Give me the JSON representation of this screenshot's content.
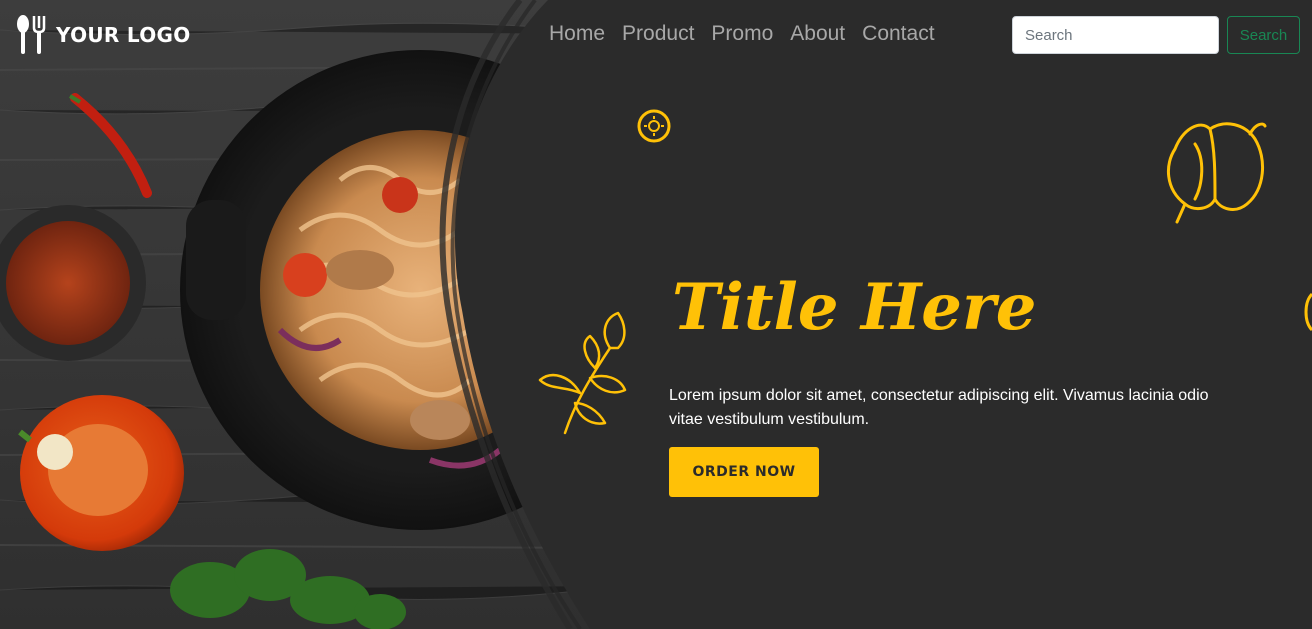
{
  "logo": {
    "text": "YOUR LOGO",
    "icon": "utensils-icon"
  },
  "nav": {
    "items": [
      "Home",
      "Product",
      "Promo",
      "About",
      "Contact"
    ]
  },
  "search": {
    "placeholder": "Search",
    "button_label": "Search"
  },
  "hero": {
    "title": "Title Here",
    "description": "Lorem ipsum dolor sit amet, consectetur adipiscing elit. Vivamus lacinia odio vitae vestibulum vestibulum.",
    "cta_label": "ORDER NOW"
  },
  "colors": {
    "accent": "#ffc107",
    "panel": "#2b2b2b",
    "success": "#198754",
    "wood": "#3b3b3b"
  },
  "decor": [
    "pepper-doodle-icon",
    "parsley-doodle-icon",
    "sun-doodle-icon"
  ]
}
